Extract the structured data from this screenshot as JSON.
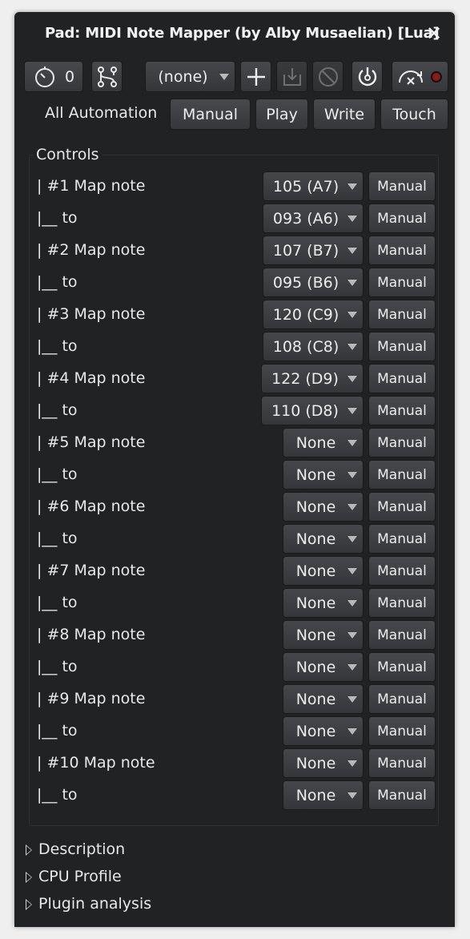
{
  "window": {
    "title": "Pad: MIDI Note Mapper (by Alby Musaelian) [Lua]",
    "close_glyph": "✕"
  },
  "toolbar": {
    "latency_value": "0",
    "preset_value": "(none)",
    "icons": [
      "timer-icon",
      "routing-icon",
      "add-preset-icon",
      "save-preset-icon",
      "delete-preset-icon",
      "bypass-power-icon",
      "pin-mode-icon",
      "record-dot-icon"
    ]
  },
  "automation": {
    "label": "All Automation",
    "buttons": [
      "Manual",
      "Play",
      "Write",
      "Touch"
    ]
  },
  "controls": {
    "header": "Controls",
    "rows": [
      {
        "label": "| #1  Map note",
        "value": "105 (A7)",
        "auto": "Manual"
      },
      {
        "label": "|__  to",
        "value": "093 (A6)",
        "auto": "Manual"
      },
      {
        "label": "| #2  Map note",
        "value": "107 (B7)",
        "auto": "Manual"
      },
      {
        "label": "|__  to",
        "value": "095 (B6)",
        "auto": "Manual"
      },
      {
        "label": "| #3  Map note",
        "value": "120 (C9)",
        "auto": "Manual"
      },
      {
        "label": "|__  to",
        "value": "108 (C8)",
        "auto": "Manual"
      },
      {
        "label": "| #4  Map note",
        "value": "122 (D9)",
        "auto": "Manual"
      },
      {
        "label": "|__  to",
        "value": "110 (D8)",
        "auto": "Manual"
      },
      {
        "label": "| #5  Map note",
        "value": "None",
        "auto": "Manual"
      },
      {
        "label": "|__  to",
        "value": "None",
        "auto": "Manual"
      },
      {
        "label": "| #6  Map note",
        "value": "None",
        "auto": "Manual"
      },
      {
        "label": "|__  to",
        "value": "None",
        "auto": "Manual"
      },
      {
        "label": "| #7  Map note",
        "value": "None",
        "auto": "Manual"
      },
      {
        "label": "|__  to",
        "value": "None",
        "auto": "Manual"
      },
      {
        "label": "| #8  Map note",
        "value": "None",
        "auto": "Manual"
      },
      {
        "label": "|__  to",
        "value": "None",
        "auto": "Manual"
      },
      {
        "label": "| #9  Map note",
        "value": "None",
        "auto": "Manual"
      },
      {
        "label": "|__  to",
        "value": "None",
        "auto": "Manual"
      },
      {
        "label": "| #10  Map note",
        "value": "None",
        "auto": "Manual"
      },
      {
        "label": "|__  to",
        "value": "None",
        "auto": "Manual"
      }
    ]
  },
  "expanders": [
    "Description",
    "CPU Profile",
    "Plugin analysis"
  ],
  "colors": {
    "window_bg": "#212224",
    "button_bg": "#3f4144",
    "record_red": "#8b1a1a"
  }
}
